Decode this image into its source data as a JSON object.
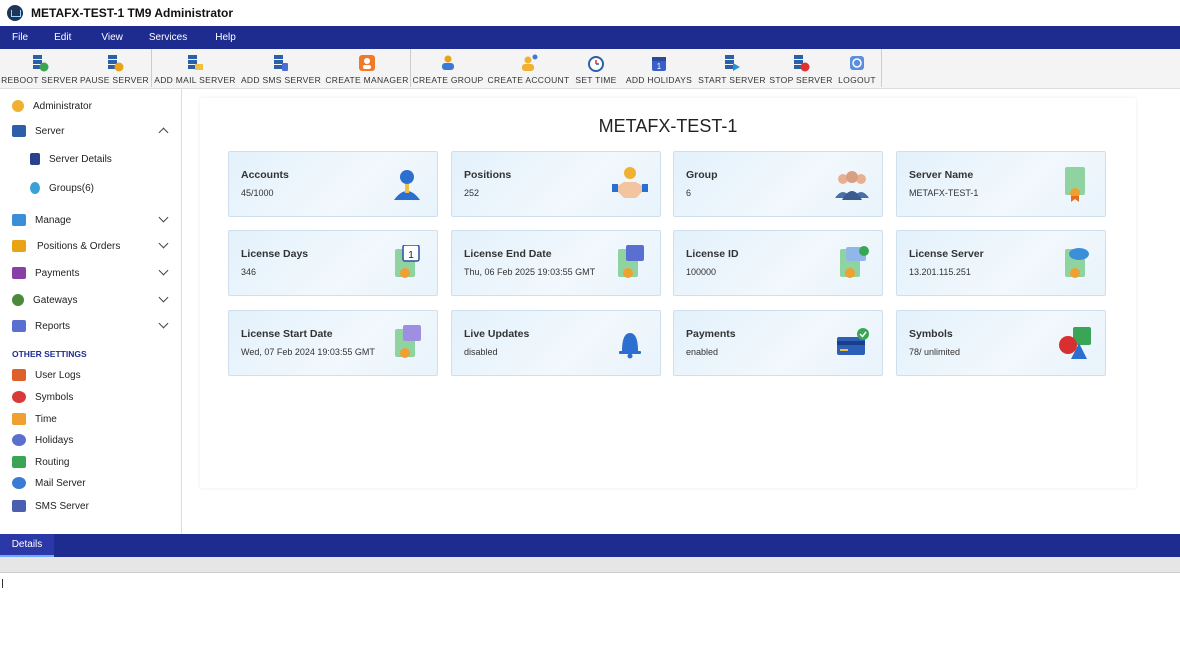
{
  "window": {
    "title": "METAFX-TEST-1 TM9 Administrator"
  },
  "menu": [
    "File",
    "Edit",
    "View",
    "Services",
    "Help"
  ],
  "toolbar": [
    {
      "label": "REBOOT SERVER",
      "icon": "reboot-server-icon"
    },
    {
      "label": "PAUSE SERVER",
      "icon": "pause-server-icon"
    },
    {
      "label": "ADD MAIL SERVER",
      "icon": "add-mail-server-icon"
    },
    {
      "label": "ADD SMS SERVER",
      "icon": "add-sms-server-icon"
    },
    {
      "label": "CREATE MANAGER",
      "icon": "create-manager-icon"
    },
    {
      "label": "CREATE GROUP",
      "icon": "create-group-icon"
    },
    {
      "label": "CREATE ACCOUNT",
      "icon": "create-account-icon"
    },
    {
      "label": "SET TIME",
      "icon": "alarm-clock-icon"
    },
    {
      "label": "ADD HOLIDAYS",
      "icon": "calendar-icon"
    },
    {
      "label": "START SERVER",
      "icon": "start-server-icon"
    },
    {
      "label": "STOP SERVER",
      "icon": "stop-server-icon"
    },
    {
      "label": "LOGOUT",
      "icon": "logout-icon"
    }
  ],
  "sidebar": {
    "items": [
      {
        "label": "Administrator",
        "icon": "administrator-icon"
      },
      {
        "label": "Server",
        "icon": "server-icon",
        "expanded": true
      },
      {
        "label": "Server Details",
        "icon": "server-details-icon"
      },
      {
        "label": "Groups(6)",
        "icon": "groups-icon"
      },
      {
        "label": "Manage",
        "icon": "manage-icon"
      },
      {
        "label": "Positions & Orders",
        "icon": "positions-orders-icon"
      },
      {
        "label": "Payments",
        "icon": "payments-icon"
      },
      {
        "label": "Gateways",
        "icon": "gateways-icon"
      },
      {
        "label": "Reports",
        "icon": "reports-icon"
      }
    ],
    "other_heading": "OTHER SETTINGS",
    "other_items": [
      {
        "label": "User Logs",
        "icon": "user-logs-icon"
      },
      {
        "label": "Symbols",
        "icon": "symbols-icon"
      },
      {
        "label": "Time",
        "icon": "time-icon"
      },
      {
        "label": "Holidays",
        "icon": "holidays-icon"
      },
      {
        "label": "Routing",
        "icon": "routing-icon"
      },
      {
        "label": "Mail Server",
        "icon": "mail-server-icon"
      },
      {
        "label": "SMS Server",
        "icon": "sms-server-icon"
      }
    ]
  },
  "main": {
    "server_title": "METAFX-TEST-1",
    "cards": [
      {
        "title": "Accounts",
        "value": "45/1000",
        "icon": "account-user-icon"
      },
      {
        "title": "Positions",
        "value": "252",
        "icon": "handshake-icon"
      },
      {
        "title": "Group",
        "value": "6",
        "icon": "group-people-icon"
      },
      {
        "title": "Server Name",
        "value": "METAFX-TEST-1",
        "icon": "certificate-icon"
      },
      {
        "title": "License Days",
        "value": "346",
        "icon": "license-calendar-icon"
      },
      {
        "title": "License End Date",
        "value": "Thu, 06 Feb 2025 19:03:55 GMT",
        "icon": "license-end-date-icon"
      },
      {
        "title": "License ID",
        "value": "100000",
        "icon": "license-id-icon"
      },
      {
        "title": "License Server",
        "value": "13.201.115.251",
        "icon": "license-server-icon"
      },
      {
        "title": "License Start Date",
        "value": "Wed, 07 Feb 2024 19:03:55 GMT",
        "icon": "license-start-date-icon"
      },
      {
        "title": "Live Updates",
        "value": "disabled",
        "icon": "bell-icon"
      },
      {
        "title": "Payments",
        "value": "enabled",
        "icon": "credit-card-icon"
      },
      {
        "title": "Symbols",
        "value": "78/ unlimited",
        "icon": "shapes-icon"
      }
    ]
  },
  "details": {
    "tab_label": "Details"
  },
  "colors": {
    "navy": "#1e2c8f",
    "card_bg": "#e3f1fb",
    "card_border": "#cfdfee"
  }
}
